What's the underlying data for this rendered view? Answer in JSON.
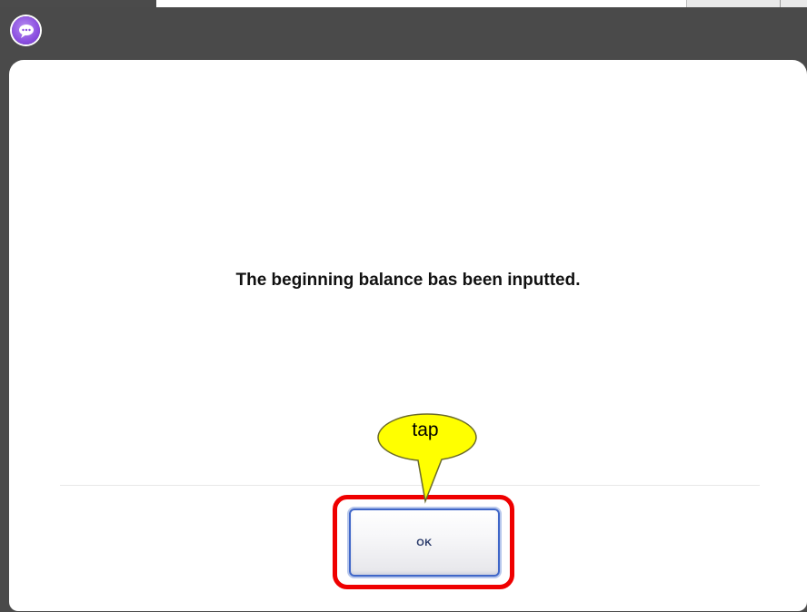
{
  "app": {
    "logo_icon": "chat-bubble-icon",
    "accent_color": "#8b4fe0"
  },
  "dialog": {
    "message": "The beginning balance bas been inputted.",
    "ok_label": "OK"
  },
  "annotation": {
    "callout_text": "tap",
    "callout_color": "#ffff00",
    "highlight_color": "#ef0000"
  }
}
